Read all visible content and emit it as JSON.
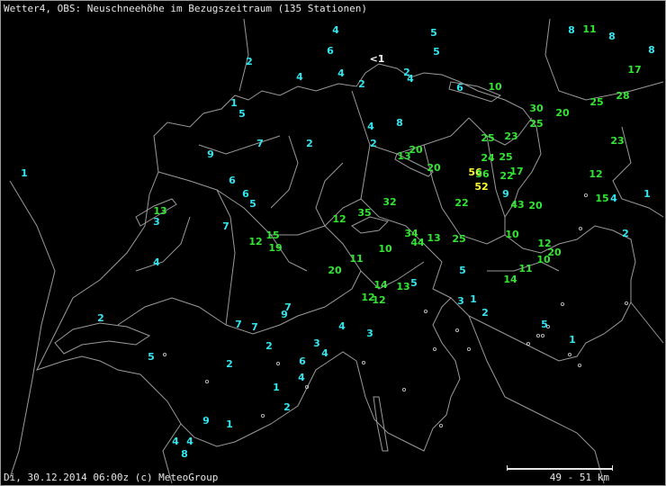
{
  "header": {
    "title": "Wetter4, OBS: Neuschneehöhe im Bezugszeitraum (135 Stationen)"
  },
  "footer": {
    "timestamp": "Di, 30.12.2014 06:00z (c) MeteoGroup"
  },
  "scale": {
    "label": "49 - 51 km"
  },
  "colors": {
    "low": "#33e6f0",
    "mid": "#33e633",
    "high": "#ffff33",
    "trace": "#ffffff",
    "borders": "#9a9a9a"
  },
  "stations": [
    {
      "t": "4",
      "c": "low"
    },
    {
      "t": "5",
      "c": "low"
    },
    {
      "t": "8",
      "c": "low"
    },
    {
      "t": "11",
      "c": "mid"
    },
    {
      "t": "8",
      "c": "low"
    },
    {
      "t": "8",
      "c": "low"
    },
    {
      "t": "2",
      "c": "low"
    },
    {
      "t": "6",
      "c": "low"
    },
    {
      "t": "<1",
      "c": "trace"
    },
    {
      "t": "5",
      "c": "low"
    },
    {
      "t": "17",
      "c": "mid"
    },
    {
      "t": "4",
      "c": "low"
    },
    {
      "t": "4",
      "c": "low"
    },
    {
      "t": "2",
      "c": "low"
    },
    {
      "t": "2",
      "c": "low"
    },
    {
      "t": "4",
      "c": "low"
    },
    {
      "t": "6",
      "c": "low"
    },
    {
      "t": "10",
      "c": "mid"
    },
    {
      "t": "28",
      "c": "mid"
    },
    {
      "t": "25",
      "c": "mid"
    },
    {
      "t": "1",
      "c": "low"
    },
    {
      "t": "5",
      "c": "low"
    },
    {
      "t": "30",
      "c": "mid"
    },
    {
      "t": "20",
      "c": "mid"
    },
    {
      "t": "8",
      "c": "low"
    },
    {
      "t": "4",
      "c": "low"
    },
    {
      "t": "25",
      "c": "mid"
    },
    {
      "t": "7",
      "c": "low"
    },
    {
      "t": "2",
      "c": "low"
    },
    {
      "t": "2",
      "c": "low"
    },
    {
      "t": "25",
      "c": "mid"
    },
    {
      "t": "23",
      "c": "mid"
    },
    {
      "t": "23",
      "c": "mid"
    },
    {
      "t": "9",
      "c": "low"
    },
    {
      "t": "13",
      "c": "mid"
    },
    {
      "t": "20",
      "c": "mid"
    },
    {
      "t": "24",
      "c": "mid"
    },
    {
      "t": "25",
      "c": "mid"
    },
    {
      "t": "20",
      "c": "mid"
    },
    {
      "t": "1",
      "c": "low"
    },
    {
      "t": "56",
      "c": "high"
    },
    {
      "t": "36",
      "c": "mid"
    },
    {
      "t": "22",
      "c": "mid"
    },
    {
      "t": "17",
      "c": "mid"
    },
    {
      "t": "12",
      "c": "mid"
    },
    {
      "t": "6",
      "c": "low"
    },
    {
      "t": "52",
      "c": "high"
    },
    {
      "t": "6",
      "c": "low"
    },
    {
      "t": "5",
      "c": "low"
    },
    {
      "t": "9",
      "c": "low"
    },
    {
      "t": "15",
      "c": "mid"
    },
    {
      "t": "4",
      "c": "low"
    },
    {
      "t": "1",
      "c": "low"
    },
    {
      "t": "13",
      "c": "mid"
    },
    {
      "t": "32",
      "c": "mid"
    },
    {
      "t": "22",
      "c": "mid"
    },
    {
      "t": "43",
      "c": "mid"
    },
    {
      "t": "20",
      "c": "mid"
    },
    {
      "t": "3",
      "c": "low"
    },
    {
      "t": "12",
      "c": "mid"
    },
    {
      "t": "35",
      "c": "mid"
    },
    {
      "t": "7",
      "c": "low"
    },
    {
      "t": "2",
      "c": "low"
    },
    {
      "t": "15",
      "c": "mid"
    },
    {
      "t": "34",
      "c": "mid"
    },
    {
      "t": "12",
      "c": "mid"
    },
    {
      "t": "13",
      "c": "mid"
    },
    {
      "t": "25",
      "c": "mid"
    },
    {
      "t": "10",
      "c": "mid"
    },
    {
      "t": "19",
      "c": "mid"
    },
    {
      "t": "44",
      "c": "mid"
    },
    {
      "t": "12",
      "c": "mid"
    },
    {
      "t": "10",
      "c": "mid"
    },
    {
      "t": "20",
      "c": "mid"
    },
    {
      "t": "10",
      "c": "mid"
    },
    {
      "t": "4",
      "c": "low"
    },
    {
      "t": "11",
      "c": "mid"
    },
    {
      "t": "20",
      "c": "mid"
    },
    {
      "t": "5",
      "c": "low"
    },
    {
      "t": "11",
      "c": "mid"
    },
    {
      "t": "14",
      "c": "mid"
    },
    {
      "t": "14",
      "c": "mid"
    },
    {
      "t": "13",
      "c": "mid"
    },
    {
      "t": "5",
      "c": "low"
    },
    {
      "t": "12",
      "c": "mid"
    },
    {
      "t": "12",
      "c": "mid"
    },
    {
      "t": "3",
      "c": "low"
    },
    {
      "t": "1",
      "c": "low"
    },
    {
      "t": "7",
      "c": "low"
    },
    {
      "t": "9",
      "c": "low"
    },
    {
      "t": "2",
      "c": "low"
    },
    {
      "t": "2",
      "c": "low"
    },
    {
      "t": "7",
      "c": "low"
    },
    {
      "t": "7",
      "c": "low"
    },
    {
      "t": "4",
      "c": "low"
    },
    {
      "t": "5",
      "c": "low"
    },
    {
      "t": "3",
      "c": "low"
    },
    {
      "t": "1",
      "c": "low"
    },
    {
      "t": "2",
      "c": "low"
    },
    {
      "t": "3",
      "c": "low"
    },
    {
      "t": "5",
      "c": "low"
    },
    {
      "t": "4",
      "c": "low"
    },
    {
      "t": "6",
      "c": "low"
    },
    {
      "t": "2",
      "c": "low"
    },
    {
      "t": "4",
      "c": "low"
    },
    {
      "t": "1",
      "c": "low"
    },
    {
      "t": "2",
      "c": "low"
    },
    {
      "t": "9",
      "c": "low"
    },
    {
      "t": "1",
      "c": "low"
    },
    {
      "t": "4",
      "c": "low"
    },
    {
      "t": "4",
      "c": "low"
    },
    {
      "t": "8",
      "c": "low"
    }
  ]
}
